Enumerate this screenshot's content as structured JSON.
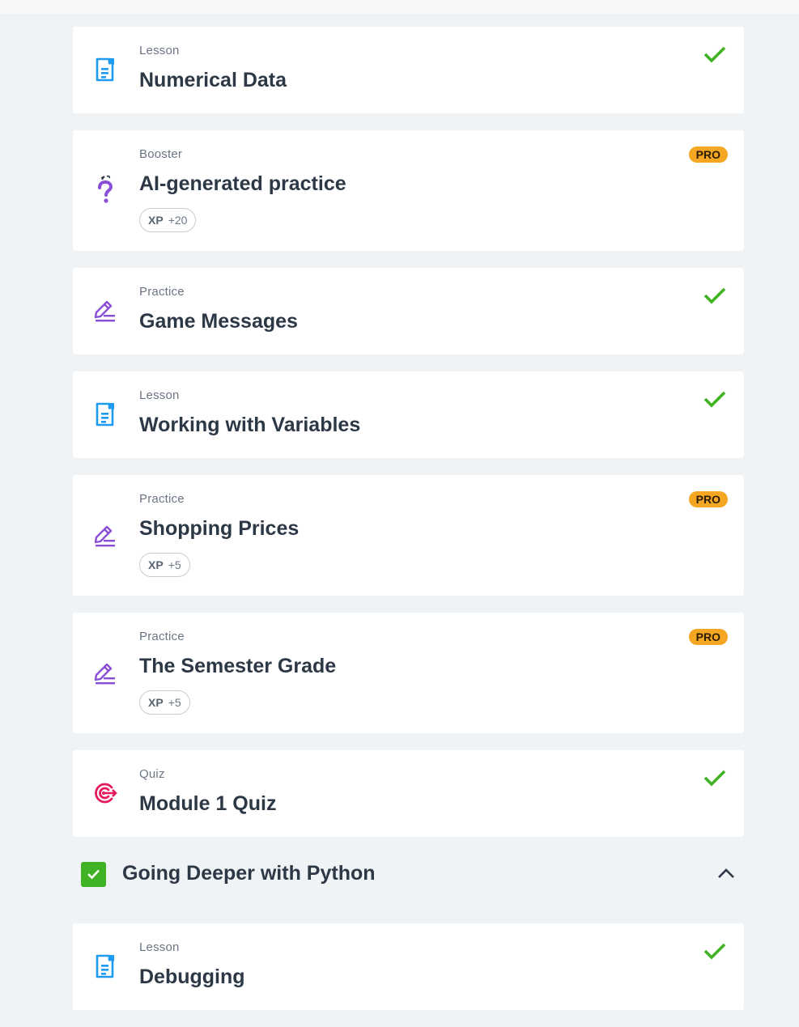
{
  "colors": {
    "background": "#f0f3f6",
    "card": "#ffffff",
    "check": "#3fb323",
    "pro": "#f5a623",
    "lesson_icon": "#1d9bf0",
    "practice_icon": "#8a4fd6",
    "quiz_icon": "#e5195f"
  },
  "items": [
    {
      "type": "Lesson",
      "title": "Numerical Data",
      "icon": "document-icon",
      "status": "completed"
    },
    {
      "type": "Booster",
      "title": "AI-generated practice",
      "icon": "question-mark-icon",
      "badge": "PRO",
      "xp_label": "XP",
      "xp_value": "+20"
    },
    {
      "type": "Practice",
      "title": "Game Messages",
      "icon": "pencil-icon",
      "status": "completed"
    },
    {
      "type": "Lesson",
      "title": "Working with Variables",
      "icon": "document-icon",
      "status": "completed"
    },
    {
      "type": "Practice",
      "title": "Shopping Prices",
      "icon": "pencil-icon",
      "badge": "PRO",
      "xp_label": "XP",
      "xp_value": "+5"
    },
    {
      "type": "Practice",
      "title": "The Semester Grade",
      "icon": "pencil-icon",
      "badge": "PRO",
      "xp_label": "XP",
      "xp_value": "+5"
    },
    {
      "type": "Quiz",
      "title": "Module 1 Quiz",
      "icon": "target-icon",
      "status": "completed"
    }
  ],
  "section": {
    "title": "Going Deeper with Python",
    "status": "completed",
    "expanded": true,
    "icon": "chevron-up-icon"
  },
  "section_items": [
    {
      "type": "Lesson",
      "title": "Debugging",
      "icon": "document-icon",
      "status": "completed"
    }
  ]
}
